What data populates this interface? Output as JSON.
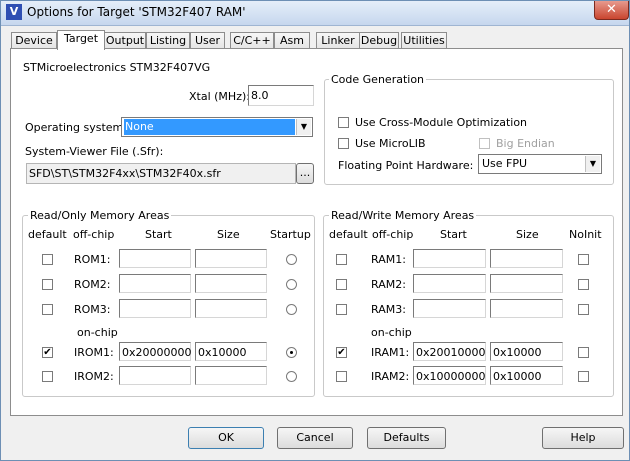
{
  "window": {
    "title": "Options for Target 'STM32F407 RAM'",
    "close_glyph": "✕",
    "icon": "keil-uvision-icon"
  },
  "tabs": [
    "Device",
    "Target",
    "Output",
    "Listing",
    "User",
    "C/C++",
    "Asm",
    "Linker",
    "Debug",
    "Utilities"
  ],
  "active_tab": "Target",
  "device_name": "STMicroelectronics STM32F407VG",
  "xtal": {
    "label": "Xtal (MHz):",
    "value": "8.0"
  },
  "os": {
    "label": "Operating system:",
    "value": "None"
  },
  "svd": {
    "label": "System-Viewer File (.Sfr):",
    "value": "SFD\\ST\\STM32F4xx\\STM32F40x.sfr",
    "browse_label": "..."
  },
  "codegen": {
    "title": "Code Generation",
    "cross_module": "Use Cross-Module Optimization",
    "microlib": "Use MicroLIB",
    "big_endian": "Big Endian",
    "fp_label": "Floating Point Hardware:",
    "fp_value": "Use FPU"
  },
  "rom": {
    "title": "Read/Only Memory Areas",
    "headers": {
      "default": "default",
      "offchip": "off-chip",
      "start": "Start",
      "size": "Size",
      "startup": "Startup"
    },
    "onchip_label": "on-chip",
    "rows": [
      {
        "name": "ROM1:",
        "start": "",
        "size": "",
        "default": false,
        "startup": false
      },
      {
        "name": "ROM2:",
        "start": "",
        "size": "",
        "default": false,
        "startup": false
      },
      {
        "name": "ROM3:",
        "start": "",
        "size": "",
        "default": false,
        "startup": false
      },
      {
        "name": "IROM1:",
        "start": "0x20000000",
        "size": "0x10000",
        "default": true,
        "startup": true
      },
      {
        "name": "IROM2:",
        "start": "",
        "size": "",
        "default": false,
        "startup": false
      }
    ]
  },
  "ram": {
    "title": "Read/Write Memory Areas",
    "headers": {
      "default": "default",
      "offchip": "off-chip",
      "start": "Start",
      "size": "Size",
      "noinit": "NoInit"
    },
    "onchip_label": "on-chip",
    "rows": [
      {
        "name": "RAM1:",
        "start": "",
        "size": "",
        "default": false,
        "noinit": false
      },
      {
        "name": "RAM2:",
        "start": "",
        "size": "",
        "default": false,
        "noinit": false
      },
      {
        "name": "RAM3:",
        "start": "",
        "size": "",
        "default": false,
        "noinit": false
      },
      {
        "name": "IRAM1:",
        "start": "0x20010000",
        "size": "0x10000",
        "default": true,
        "noinit": false
      },
      {
        "name": "IRAM2:",
        "start": "0x10000000",
        "size": "0x10000",
        "default": false,
        "noinit": false
      }
    ]
  },
  "buttons": {
    "ok": "OK",
    "cancel": "Cancel",
    "defaults": "Defaults",
    "help": "Help"
  }
}
